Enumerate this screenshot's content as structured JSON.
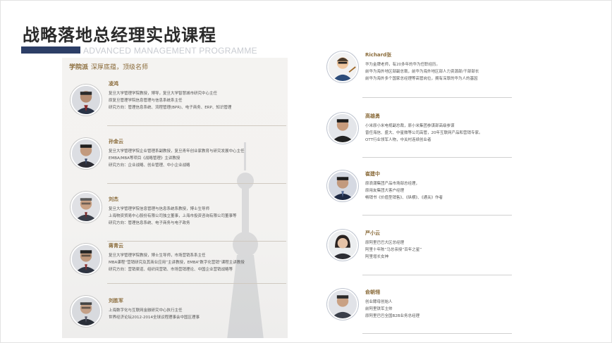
{
  "header": {
    "title": "战略落地总经理实战课程",
    "subtitle_en": "ADVANCED MANAGEMENT PROGRAMME",
    "accent_color": "#2c3e66"
  },
  "left_panel": {
    "heading": "学院派",
    "heading_tag": "深厚底蕴，顶级名师",
    "people": [
      {
        "name": "凌鸿",
        "lines": [
          "复旦大学管理学院教授，博导，复旦大学智慧城市研究中心主任",
          "原复旦管理学院信息管理与信息系统系主任",
          "研究方向：管理信息系统、流程管理(BPR)、电子商务、ERP、知识管理"
        ]
      },
      {
        "name": "孙金云",
        "lines": [
          "复旦大学管理学院企业管理系副教授，复旦青年创业家教育与研究发展中心主任",
          "EMBA/MBA等项目《战略管理》主讲教授",
          "研究方向：企业战略、创业管理、中小企业战略"
        ]
      },
      {
        "name": "刘杰",
        "lines": [
          "复旦大学管理学院信息管理与信息系统系教授，博士生导师",
          "上海物资贸易中心股份有限公司独立董事，上海市投资咨询有限公司董事等",
          "研究方向：管理信息系统、电子商务与电子政务"
        ]
      },
      {
        "name": "蒋青云",
        "lines": [
          "复旦大学管理学院教授，博士生导师，市场营销系系主任",
          "MBA课程“营销研究及其商业应用”主讲教授，EMBA“数字化营销”课程主讲教授",
          "研究方向：营销渠道、组织间营销、市场营销理论、中国企业营销战略等"
        ]
      },
      {
        "name": "刘胜军",
        "lines": [
          "上海数字化与互联网金融研究中心执行主任",
          "世界经济论坛2012-2014全球议程理事会中国区理事"
        ]
      }
    ]
  },
  "right_column": {
    "people": [
      {
        "name": "Richard张",
        "lines": [
          "华为金牌老师，有20多年的华为任职经历。",
          "前华为海外地区部副总裁，前华为海外地区部人力资源部/干部部长",
          "前华为海外多个国家总经理等高管岗位，拥有深厚的华为人的基因"
        ]
      },
      {
        "name": "高雄勇",
        "lines": [
          "小米原小米电视副总裁，原小米集团参谋部高级参谋",
          "曾任海信、盛大、中星微等公司高管，20年互联网产品和营销专家。",
          "OTT行业领军人物，中关村连续创业者"
        ]
      },
      {
        "name": "崔建中",
        "lines": [
          "原浪潮集团产品市场部总经理，",
          "原用友集团大客户经理",
          "畅销书《价值型销售》、《纵横》、《通关》作者"
        ]
      },
      {
        "name": "严小云",
        "lines": [
          "原阿里巴巴大区总经理",
          "阿里十年陈“马总亲授”百年之星”",
          "阿里增长女神"
        ]
      },
      {
        "name": "俞朝翎",
        "lines": [
          "创业酵母创始人",
          "前阿里铁军主帅",
          "原阿里巴巴全国B2B业务总经理"
        ]
      }
    ]
  }
}
